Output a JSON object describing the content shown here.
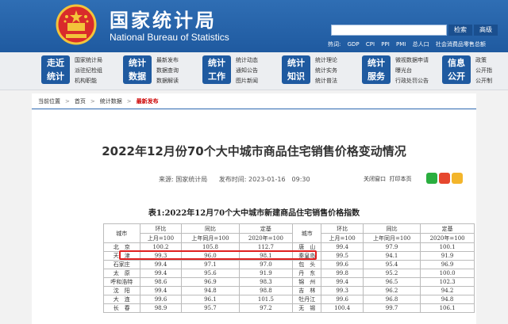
{
  "header": {
    "site_name_cn": "国家统计局",
    "site_name_en": "National Bureau of Statistics",
    "search_button": "检索",
    "advanced_button": "高级",
    "hot_words_label": "热词:",
    "hot_words": [
      "GDP",
      "CPI",
      "PPI",
      "PMI",
      "总人口",
      "社会消费品零售总额"
    ]
  },
  "nav": [
    {
      "title_line1": "走近",
      "title_line2": "统计",
      "links": [
        "国家统计局",
        "派驻纪检组",
        "机构职能"
      ]
    },
    {
      "title_line1": "统计",
      "title_line2": "数据",
      "links": [
        "最新发布",
        "数据查询",
        "数据解读"
      ]
    },
    {
      "title_line1": "统计",
      "title_line2": "工作",
      "links": [
        "统计动态",
        "通知公告",
        "图片新闻"
      ]
    },
    {
      "title_line1": "统计",
      "title_line2": "知识",
      "links": [
        "统计理论",
        "统计实务",
        "统计普法"
      ]
    },
    {
      "title_line1": "统计",
      "title_line2": "服务",
      "links": [
        "微视数据申请",
        "曝光台",
        "行政处罚公告"
      ]
    },
    {
      "title_line1": "信息",
      "title_line2": "公开",
      "links": [
        "政策",
        "公开指",
        "公开制"
      ]
    }
  ],
  "breadcrumb": {
    "label": "当前位置",
    "items": [
      "首页",
      "统计数据"
    ],
    "current": "最新发布"
  },
  "article": {
    "title": "2022年12月份70个大中城市商品住宅销售价格变动情况",
    "source_label": "来源:",
    "source": "国家统计局",
    "date_label": "发布时间:",
    "date": "2023-01-16　09:30",
    "close_window": "关闭窗口",
    "print_page": "打印本页"
  },
  "table": {
    "title": "表1:2022年12月70个大中城市新建商品住宅销售价格指数",
    "city_header": "城市",
    "group_headers": [
      "环比",
      "同比",
      "定基"
    ],
    "sub_headers": [
      "上月=100",
      "上年同月=100",
      "2020年=100"
    ],
    "rows": [
      [
        "北　京",
        "100.2",
        "105.8",
        "112.7",
        "唐　山",
        "99.4",
        "97.9",
        "100.1"
      ],
      [
        "天　津",
        "99.3",
        "96.0",
        "98.1",
        "秦皇岛",
        "99.5",
        "94.1",
        "91.9"
      ],
      [
        "石家庄",
        "99.4",
        "97.1",
        "97.0",
        "包　头",
        "99.6",
        "95.4",
        "96.9"
      ],
      [
        "太　原",
        "99.4",
        "95.6",
        "91.9",
        "丹　东",
        "99.8",
        "95.2",
        "100.0"
      ],
      [
        "呼和浩特",
        "98.6",
        "96.9",
        "98.3",
        "锦　州",
        "99.4",
        "96.5",
        "102.3"
      ],
      [
        "沈　阳",
        "99.4",
        "94.8",
        "98.8",
        "吉　林",
        "99.3",
        "96.2",
        "94.2"
      ],
      [
        "大　连",
        "99.6",
        "96.1",
        "101.5",
        "牡丹江",
        "99.6",
        "96.8",
        "94.8"
      ],
      [
        "长　春",
        "98.9",
        "95.7",
        "97.2",
        "无　锡",
        "100.4",
        "99.7",
        "106.1"
      ]
    ]
  },
  "colors": {
    "brand_blue": "#1f5aa0",
    "highlight_red": "#e02020",
    "current_red": "#cc0000"
  }
}
